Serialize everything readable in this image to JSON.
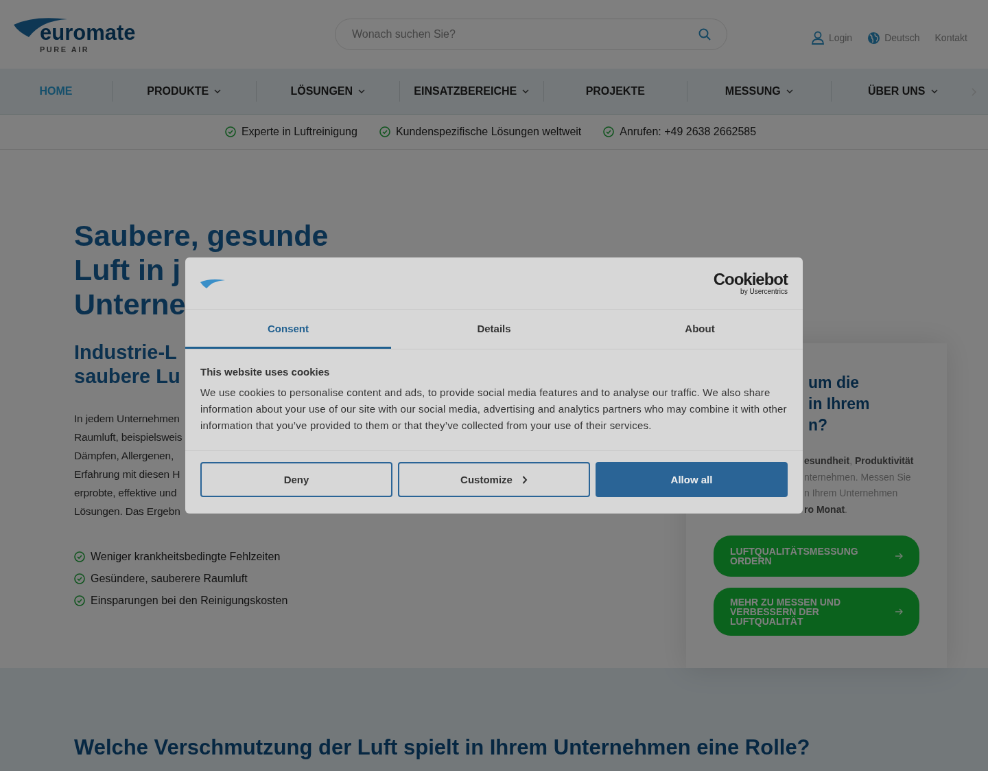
{
  "header": {
    "logo": {
      "name": "euromate",
      "tagline": "PURE AIR"
    },
    "search": {
      "placeholder": "Wonach suchen Sie?"
    },
    "links": [
      {
        "kind": "login",
        "label": "Login"
      },
      {
        "kind": "language",
        "label": "Deutsch"
      },
      {
        "kind": "plain",
        "label": "Kontakt"
      }
    ]
  },
  "nav": {
    "items": [
      {
        "label": "HOME",
        "selected": true,
        "dropdown": false
      },
      {
        "label": "PRODUKTE",
        "selected": false,
        "dropdown": true
      },
      {
        "label": "LÖSUNGEN",
        "selected": false,
        "dropdown": true
      },
      {
        "label": "EINSATZBEREICHE",
        "selected": false,
        "dropdown": true
      },
      {
        "label": "PROJEKTE",
        "selected": false,
        "dropdown": false
      },
      {
        "label": "MESSUNG",
        "selected": false,
        "dropdown": true
      },
      {
        "label": "ÜBER UNS",
        "selected": false,
        "dropdown": true
      }
    ]
  },
  "usps": [
    "Experte in Luftreinigung",
    "Kundenspezifische Lösungen weltweit",
    "Anrufen: +49 2638 2662585"
  ],
  "hero": {
    "title_lines": [
      "Saubere, gesunde",
      "Luft in j",
      "Unterne"
    ],
    "subtitle_lines": [
      "Industrie-L",
      "saubere Lu"
    ],
    "paragraph_lines": [
      "In jedem Unternehmen",
      "Raumluft, beispielsweis",
      "Dämpfen, Allergenen,",
      "Erfahrung mit diesen H",
      "erprobte, effektive und",
      "Lösungen. Das Ergebn"
    ],
    "benefits": [
      "Weniger krankheitsbedingte Fehlzeiten",
      "Gesündere, sauberere Raumluft",
      "Einsparungen bei den Reinigungskosten"
    ]
  },
  "card": {
    "title_lines": [
      "um die",
      "in Ihrem",
      "n?"
    ],
    "text_lines": [
      "**esundheit**, **Produktivität**",
      "nternehmen. Messen Sie",
      "n Ihrem Unternehmen",
      "**ro Monat**."
    ],
    "buttons": [
      "LUFTQUALITÄTSMESSUNG ORDERN",
      "MEHR ZU MESSEN UND VERBESSERN DER LUFTQUALITÄT"
    ]
  },
  "section": {
    "title": "Welche Verschmutzung der Luft spielt in Ihrem Unternehmen eine Rolle?"
  },
  "cookie_dialog": {
    "brand": {
      "name": "Cookiebot",
      "byline": "by Usercentrics"
    },
    "tabs": [
      {
        "label": "Consent",
        "selected": true
      },
      {
        "label": "Details",
        "selected": false
      },
      {
        "label": "About",
        "selected": false
      }
    ],
    "heading": "This website uses cookies",
    "text": "We use cookies to personalise content and ads, to provide social media features and to analyse our traffic. We also share information about your use of our site with our social media, advertising and analytics partners who may combine it with other information that you’ve provided to them or that they’ve collected from your use of their services.",
    "buttons": [
      {
        "kind": "outline",
        "label": "Deny"
      },
      {
        "kind": "chevron",
        "label": "Customize"
      },
      {
        "kind": "primary",
        "label": "Allow all"
      }
    ]
  }
}
